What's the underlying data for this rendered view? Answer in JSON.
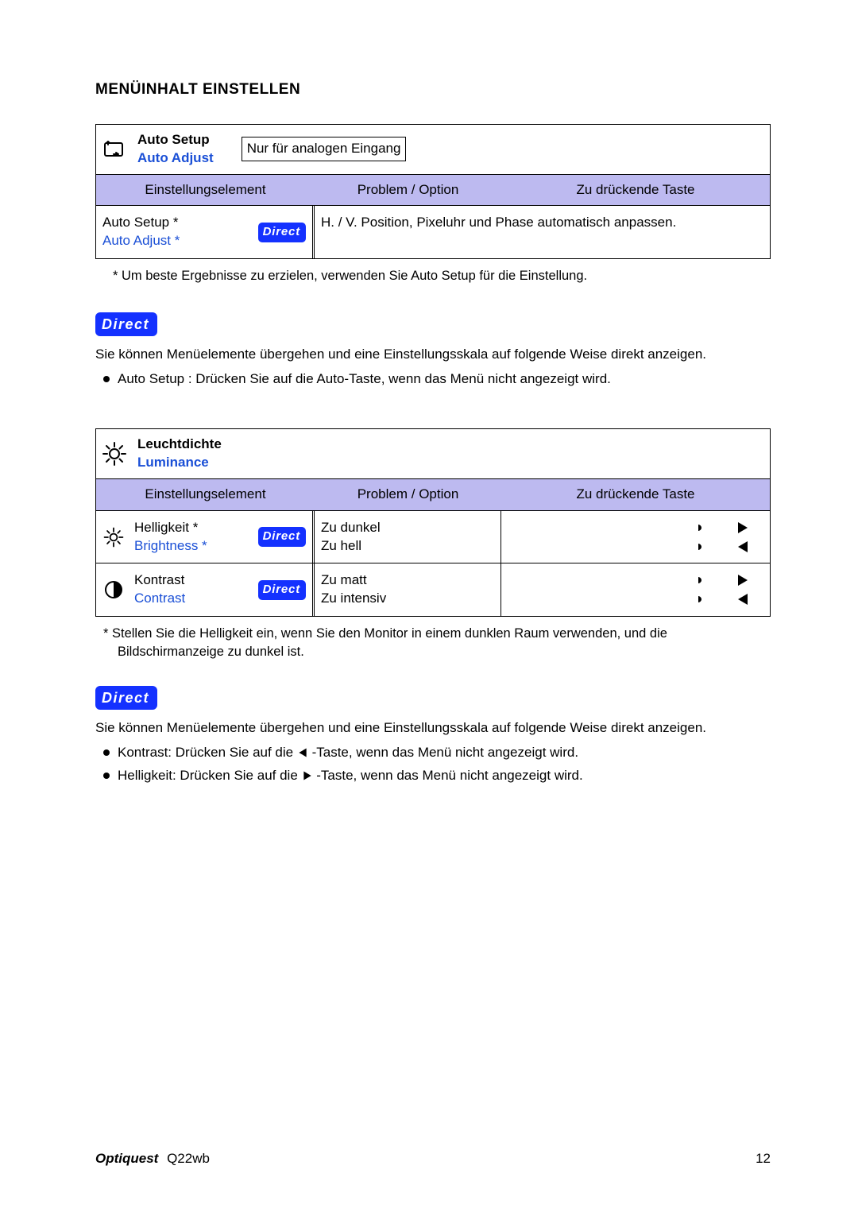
{
  "heading": "MENÜINHALT EINSTELLEN",
  "table1": {
    "title_de": "Auto Setup",
    "title_en": "Auto Adjust",
    "analog_note": "Nur für analogen Eingang",
    "col_a": "Einstellungselement",
    "col_b": "Problem / Option",
    "col_c": "Zu drückende Taste",
    "row": {
      "de": "Auto Setup *",
      "en": "Auto Adjust *",
      "direct": "Direct",
      "desc": "H. / V. Position, Pixeluhr und Phase automatisch anpassen."
    }
  },
  "footnote1": "*   Um beste Ergebnisse zu erzielen, verwenden Sie Auto Setup für die Einstellung.",
  "direct_badge": "Direct",
  "direct1_para": "Sie können Menüelemente übergehen und eine Einstellungsskala auf folgende Weise direkt anzeigen.",
  "direct1_bullet": "Auto Setup : Drücken Sie auf die Auto-Taste, wenn das Menü nicht angezeigt wird.",
  "table2": {
    "title_de": "Leuchtdichte",
    "title_en": "Luminance",
    "col_a": "Einstellungselement",
    "col_b": "Problem / Option",
    "col_c": "Zu drückende Taste",
    "row1": {
      "de": "Helligkeit *",
      "en": "Brightness *",
      "direct": "Direct",
      "opt1": "Zu dunkel",
      "opt2": "Zu hell"
    },
    "row2": {
      "de": "Kontrast",
      "en": "Contrast",
      "direct": "Direct",
      "opt1": "Zu matt",
      "opt2": "Zu intensiv"
    }
  },
  "footnote2": "*   Stellen Sie die Helligkeit ein, wenn Sie den Monitor in einem dunklen Raum verwenden, und die Bildschirmanzeige zu dunkel ist.",
  "direct2_para": "Sie können Menüelemente übergehen und eine Einstellungsskala auf folgende Weise direkt anzeigen.",
  "direct2_b1a": "Kontrast: Drücken Sie auf die ",
  "direct2_b1b": " -Taste, wenn das Menü nicht angezeigt wird.",
  "direct2_b2a": "Helligkeit: Drücken Sie auf die ",
  "direct2_b2b": " -Taste, wenn das Menü nicht angezeigt wird.",
  "footer": {
    "brand": "Optiquest",
    "model": "Q22wb",
    "page": "12"
  }
}
